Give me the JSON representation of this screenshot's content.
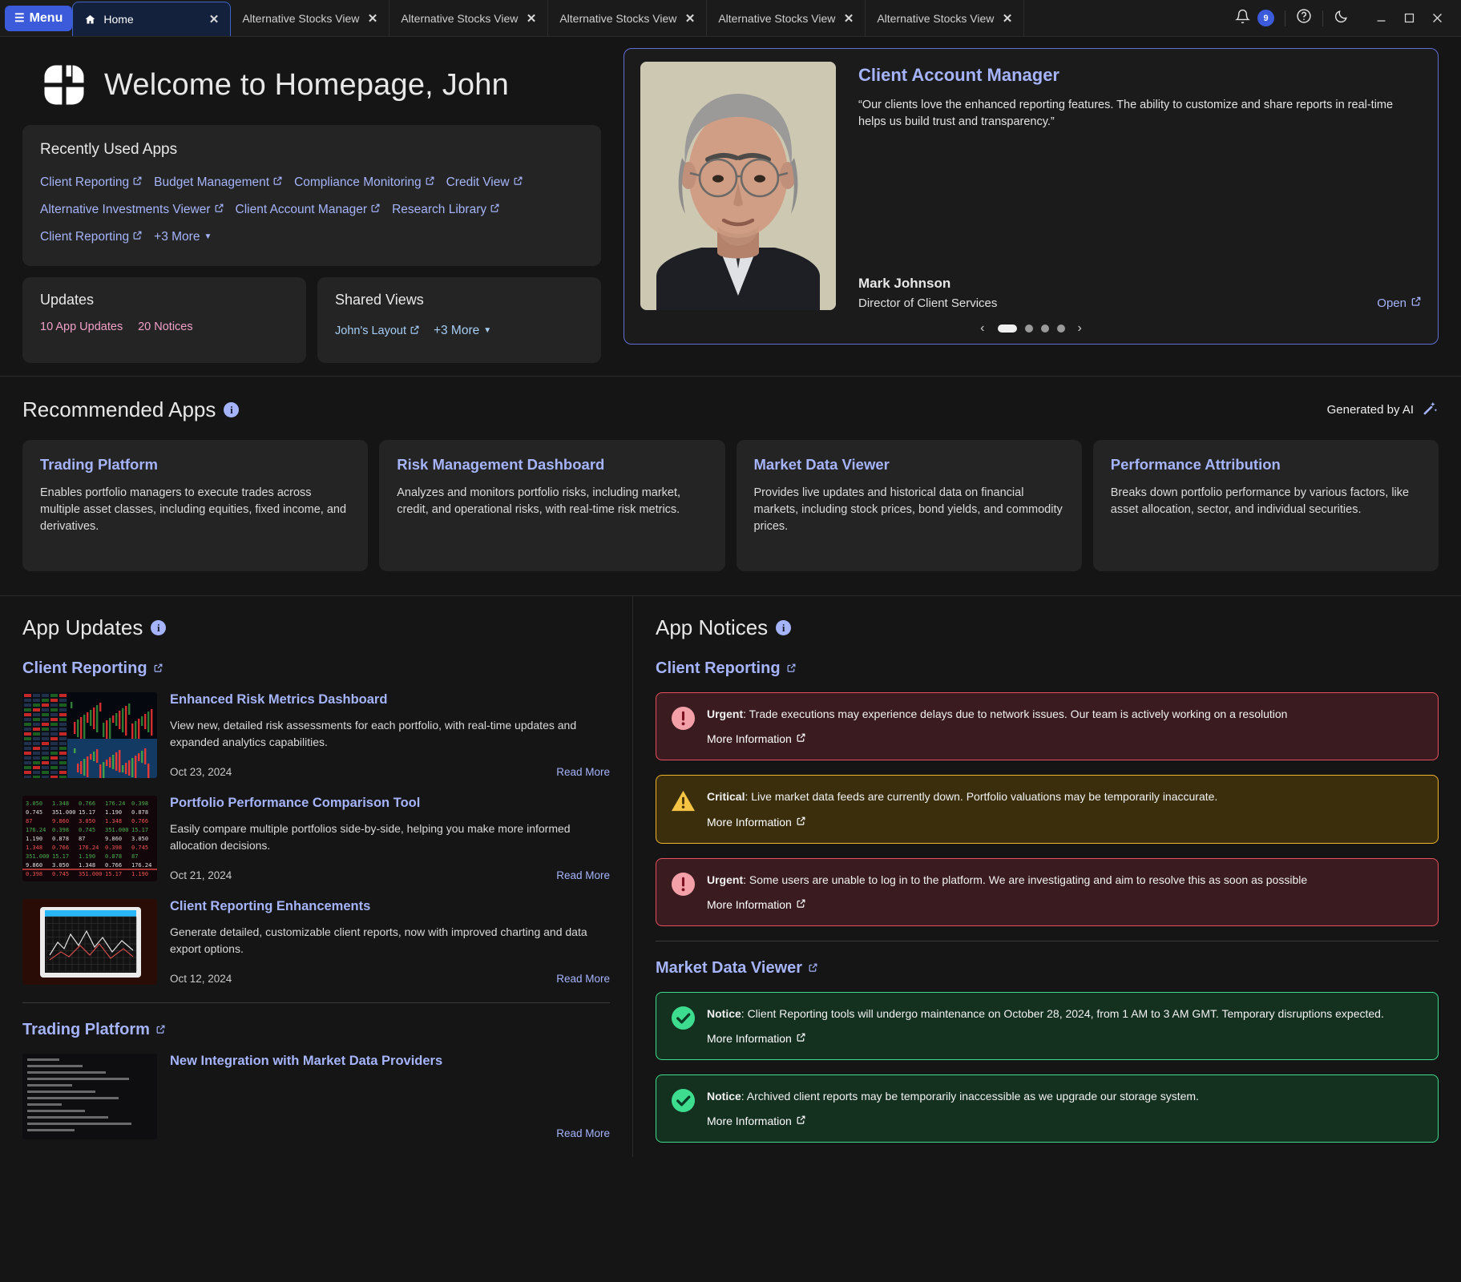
{
  "window": {
    "menu_label": "Menu",
    "notification_count": "9",
    "icons": {
      "menu": "hamburger-icon",
      "bell": "bell-icon",
      "help": "help-circle-icon",
      "theme": "moon-icon",
      "minimize": "minimize-icon",
      "maximize": "maximize-icon",
      "close": "close-icon"
    },
    "tabs": [
      {
        "label": "Home",
        "active": true,
        "icon": "home-icon"
      },
      {
        "label": "Alternative Stocks View",
        "active": false
      },
      {
        "label": "Alternative Stocks View",
        "active": false
      },
      {
        "label": "Alternative Stocks View",
        "active": false
      },
      {
        "label": "Alternative Stocks View",
        "active": false
      },
      {
        "label": "Alternative Stocks View",
        "active": false
      }
    ],
    "tab_close_label": "✕"
  },
  "hero": {
    "welcome_title": "Welcome to Homepage, John",
    "logo_name": "octagon-pinwheel-logo",
    "recently_used": {
      "title": "Recently Used Apps",
      "apps": [
        "Client Reporting",
        "Budget Management",
        "Compliance Monitoring",
        "Credit View",
        "Alternative Investments Viewer",
        "Client Account Manager",
        "Research Library",
        "Client Reporting"
      ],
      "more_label": "+3 More"
    },
    "updates": {
      "title": "Updates",
      "app_updates": "10 App Updates",
      "notices": "20 Notices"
    },
    "shared_views": {
      "title": "Shared Views",
      "layout": "John's Layout",
      "more_label": "+3 More"
    }
  },
  "profile_card": {
    "role": "Client Account Manager",
    "quote": "“Our clients love the enhanced reporting features. The ability to customize and share reports in real-time helps us build trust and transparency.”",
    "name": "Mark Johnson",
    "title": "Director of Client Services",
    "open_label": "Open",
    "carousel": {
      "total": 4,
      "active_index": 0,
      "prev": "‹",
      "next": "›"
    }
  },
  "recommended": {
    "title": "Recommended Apps",
    "generated_by_ai": "Generated by AI",
    "cards": [
      {
        "title": "Trading Platform",
        "desc": "Enables portfolio managers to execute trades across multiple asset classes, including equities, fixed income, and derivatives."
      },
      {
        "title": "Risk Management Dashboard",
        "desc": "Analyzes and monitors portfolio risks, including market, credit, and operational risks, with real-time risk metrics."
      },
      {
        "title": "Market Data Viewer",
        "desc": "Provides live updates and historical data on financial markets, including stock prices, bond yields, and commodity prices."
      },
      {
        "title": "Performance Attribution",
        "desc": "Breaks down portfolio performance by various factors, like asset allocation, sector, and individual securities."
      }
    ]
  },
  "app_updates": {
    "title": "App Updates",
    "groups": [
      {
        "app": "Client Reporting",
        "items": [
          {
            "title": "Enhanced Risk Metrics Dashboard",
            "desc": "View new, detailed risk assessments for each portfolio, with real-time updates and expanded analytics capabilities.",
            "date": "Oct 23, 2024",
            "read_more": "Read More",
            "thumb": "trading-terminal-thumbnail"
          },
          {
            "title": "Portfolio Performance Comparison Tool",
            "desc": "Easily compare multiple portfolios side-by-side, helping you make more informed allocation decisions.",
            "date": "Oct 21, 2024",
            "read_more": "Read More",
            "thumb": "market-ticker-thumbnail"
          },
          {
            "title": "Client Reporting Enhancements",
            "desc": "Generate detailed, customizable client reports, now with improved charting and data export options.",
            "date": "Oct 12, 2024",
            "read_more": "Read More",
            "thumb": "tablet-chart-thumbnail"
          }
        ]
      },
      {
        "app": "Trading Platform",
        "items": [
          {
            "title": "New Integration with Market Data Providers",
            "desc": "",
            "date": "",
            "read_more": "Read More",
            "thumb": "data-screen-thumbnail"
          }
        ]
      }
    ]
  },
  "app_notices": {
    "title": "App Notices",
    "more_information": "More Information",
    "groups": [
      {
        "app": "Client Reporting",
        "notices": [
          {
            "severity": "urgent",
            "label": "Urgent",
            "text": ": Trade executions may experience delays due to network issues. Our team is actively working on a resolution",
            "icon": "exclamation-circle-icon"
          },
          {
            "severity": "critical",
            "label": "Critical",
            "text": ": Live market data feeds are currently down. Portfolio valuations may be temporarily inaccurate.",
            "icon": "warning-triangle-icon"
          },
          {
            "severity": "urgent",
            "label": "Urgent",
            "text": ": Some users are unable to log in to the platform. We are investigating and aim to resolve this as soon as possible",
            "icon": "exclamation-circle-icon"
          }
        ]
      },
      {
        "app": "Market Data Viewer",
        "notices": [
          {
            "severity": "ok",
            "label": "Notice",
            "text": ": Client Reporting tools will undergo maintenance on October 28, 2024, from 1 AM to 3 AM GMT. Temporary disruptions expected.",
            "icon": "check-circle-icon"
          },
          {
            "severity": "ok",
            "label": "Notice",
            "text": ": Archived client reports may be temporarily inaccessible as we upgrade our storage system.",
            "icon": "check-circle-icon"
          }
        ]
      }
    ]
  },
  "colors": {
    "accent_blue": "#3b5bdb",
    "link_lavender": "#a5b4fc",
    "pink": "#f0a0c8",
    "urgent_red": "#e8505f",
    "critical_yellow": "#f0b429",
    "ok_green": "#3ddc8f",
    "bg": "#151515",
    "card_bg": "#242424"
  }
}
